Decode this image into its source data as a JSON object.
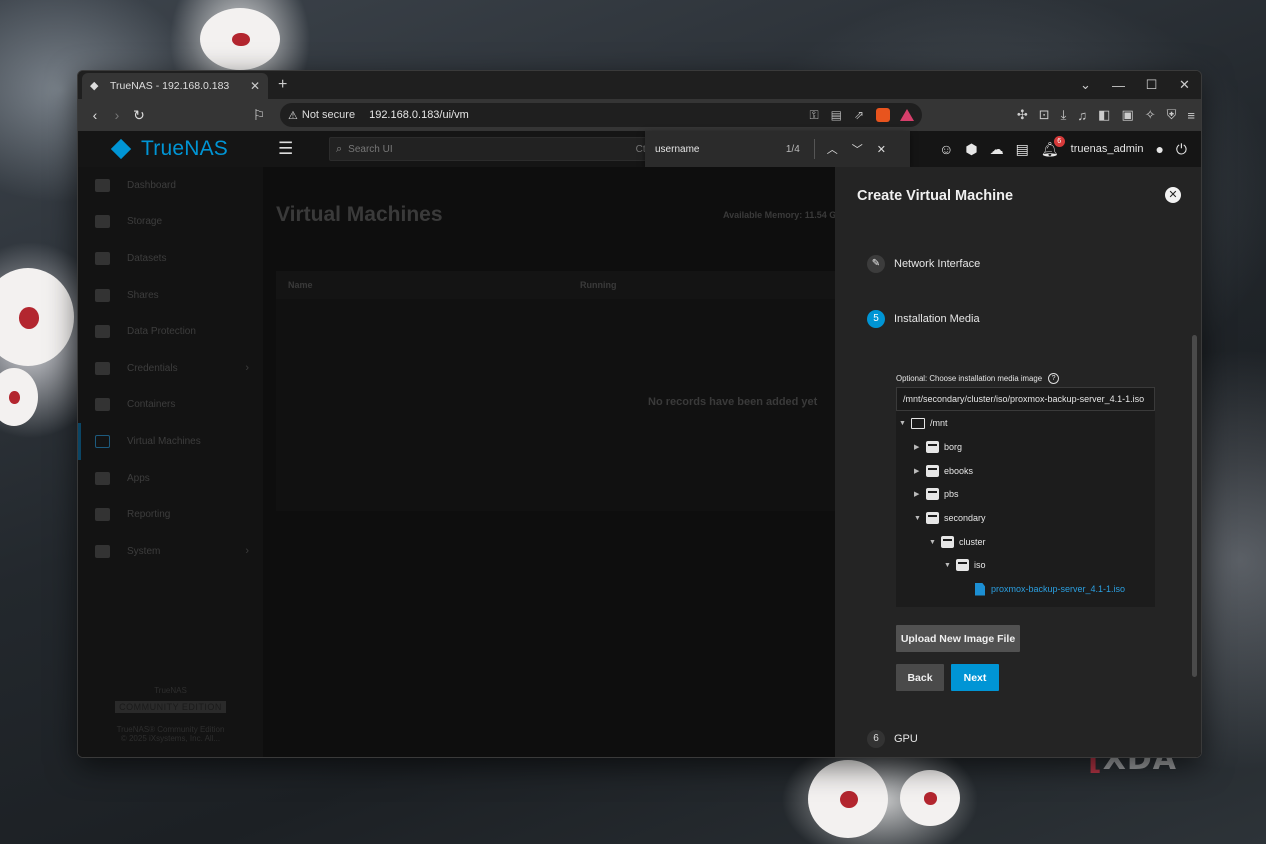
{
  "browser": {
    "tab_title": "TrueNAS - 192.168.0.183",
    "security_label": "Not secure",
    "url": "192.168.0.183/ui/vm"
  },
  "truenas": {
    "brand": "TrueNAS",
    "search_placeholder": "Search UI",
    "search_shortcut": "Ctrl+",
    "find": {
      "query": "username",
      "count": "1/4"
    },
    "user": "truenas_admin",
    "notifications": "6"
  },
  "sidebar": {
    "items": [
      {
        "label": "Dashboard",
        "icon": "dashboard-icon"
      },
      {
        "label": "Storage",
        "icon": "storage-icon"
      },
      {
        "label": "Datasets",
        "icon": "datasets-icon"
      },
      {
        "label": "Shares",
        "icon": "shares-icon"
      },
      {
        "label": "Data Protection",
        "icon": "shield-icon"
      },
      {
        "label": "Credentials",
        "icon": "key-icon",
        "arrow": true
      },
      {
        "label": "Containers",
        "icon": "cube-icon"
      },
      {
        "label": "Virtual Machines",
        "icon": "monitor-icon",
        "active": true
      },
      {
        "label": "Apps",
        "icon": "apps-grid-icon"
      },
      {
        "label": "Reporting",
        "icon": "chart-icon"
      },
      {
        "label": "System",
        "icon": "gear-icon",
        "arrow": true
      }
    ],
    "footer": {
      "brand": "TrueNAS",
      "edition": "COMMUNITY EDITION",
      "line1": "TrueNAS® Community Edition",
      "line2": "© 2025 iXsystems, Inc. All..."
    }
  },
  "main": {
    "title": "Virtual Machines",
    "memory_label": "Available Memory: 11.54 GiB",
    "col_name": "Name",
    "col_running": "Running",
    "empty": "No records have been added yet"
  },
  "panel": {
    "title": "Create Virtual Machine",
    "steps": {
      "network": "Network Interface",
      "install_num": "5",
      "install": "Installation Media",
      "gpu_num": "6",
      "gpu": "GPU"
    },
    "media_label": "Optional: Choose installation media image",
    "media_path": "/mnt/secondary/cluster/iso/proxmox-backup-server_4.1-1.iso",
    "tree": {
      "root": "/mnt",
      "borg": "borg",
      "ebooks": "ebooks",
      "pbs": "pbs",
      "secondary": "secondary",
      "cluster": "cluster",
      "iso": "iso",
      "file": "proxmox-backup-server_4.1-1.iso"
    },
    "upload_label": "Upload New Image File",
    "back_label": "Back",
    "next_label": "Next"
  },
  "colors": {
    "accent": "#0095d5",
    "panel_bg": "#242424"
  },
  "watermark": "XDA"
}
